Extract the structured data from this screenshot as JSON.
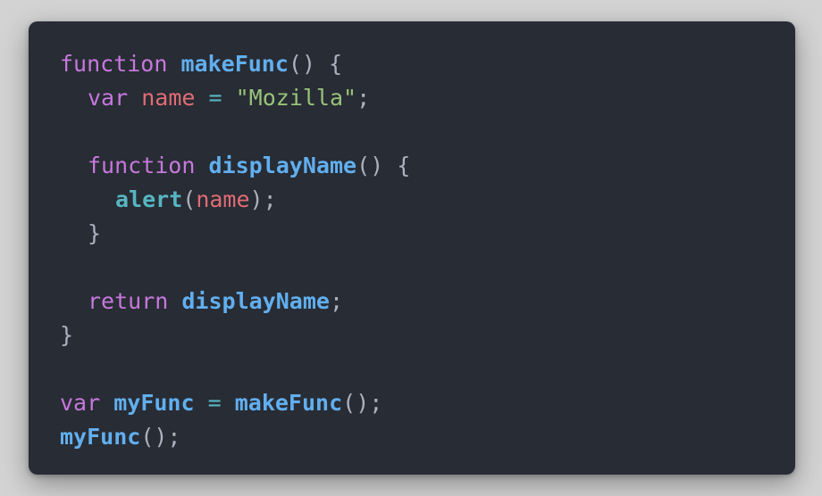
{
  "colors": {
    "background": "#d3d3d3",
    "editor_bg": "#282c34",
    "keyword": "#c678dd",
    "function_name": "#61afef",
    "variable": "#e06c75",
    "operator": "#56b6c2",
    "string": "#98c379",
    "builtin": "#56b6c2",
    "punctuation": "#abb2bf"
  },
  "code": {
    "l1": {
      "kw": "function",
      "fn": "makeFunc",
      "rest": "() {"
    },
    "l2": {
      "kw": "var",
      "var": "name",
      "op": "=",
      "str": "\"Mozilla\"",
      "end": ";"
    },
    "l4": {
      "kw": "function",
      "fn": "displayName",
      "rest": "() {"
    },
    "l5": {
      "call": "alert",
      "open": "(",
      "arg": "name",
      "close": ");"
    },
    "l6": {
      "text": "}"
    },
    "l8": {
      "kw": "return",
      "fn": "displayName",
      "end": ";"
    },
    "l9": {
      "text": "}"
    },
    "l11": {
      "kw": "var",
      "var": "myFunc",
      "op": "=",
      "fn": "makeFunc",
      "end": "();"
    },
    "l12": {
      "fn": "myFunc",
      "end": "();"
    }
  }
}
